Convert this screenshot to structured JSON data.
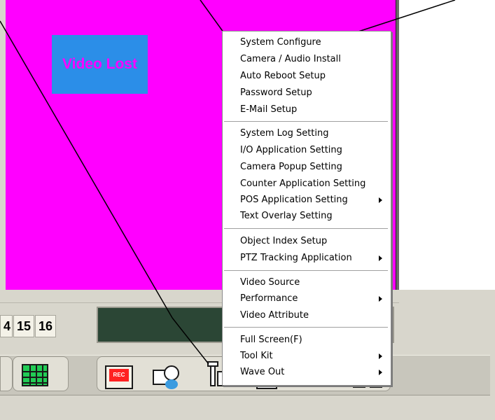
{
  "video": {
    "status_label": "Video Lost",
    "badge_bg": "#2b8ee8",
    "badge_text_color": "#ff00ff",
    "area_bg": "#ff00ff"
  },
  "camera_numbers": [
    "4",
    "15",
    "16"
  ],
  "toolbar": {
    "rec_label": "REC",
    "icons": [
      "layout-icon",
      "grid-icon",
      "record-icon",
      "schedule-icon",
      "config-icon",
      "search-icon",
      "network-icon",
      "dual-monitor-icon"
    ]
  },
  "menu": {
    "groups": [
      [
        {
          "label": "System Configure",
          "submenu": false
        },
        {
          "label": "Camera / Audio Install",
          "submenu": false
        },
        {
          "label": "Auto Reboot Setup",
          "submenu": false
        },
        {
          "label": "Password Setup",
          "submenu": false
        },
        {
          "label": "E-Mail Setup",
          "submenu": false
        }
      ],
      [
        {
          "label": "System Log Setting",
          "submenu": false
        },
        {
          "label": "I/O Application Setting",
          "submenu": false
        },
        {
          "label": "Camera Popup Setting",
          "submenu": false
        },
        {
          "label": "Counter Application Setting",
          "submenu": false
        },
        {
          "label": "POS Application Setting",
          "submenu": true
        },
        {
          "label": "Text Overlay Setting",
          "submenu": false
        }
      ],
      [
        {
          "label": "Object Index Setup",
          "submenu": false
        },
        {
          "label": "PTZ Tracking Application",
          "submenu": true
        }
      ],
      [
        {
          "label": "Video Source",
          "submenu": false
        },
        {
          "label": "Performance",
          "submenu": true
        },
        {
          "label": "Video Attribute",
          "submenu": false
        }
      ],
      [
        {
          "label": "Full Screen(F)",
          "submenu": false
        },
        {
          "label": "Tool Kit",
          "submenu": true
        },
        {
          "label": "Wave Out",
          "submenu": true
        }
      ]
    ]
  },
  "colors": {
    "status_bar": "#2b4635",
    "panel": "#d8d6cc"
  }
}
